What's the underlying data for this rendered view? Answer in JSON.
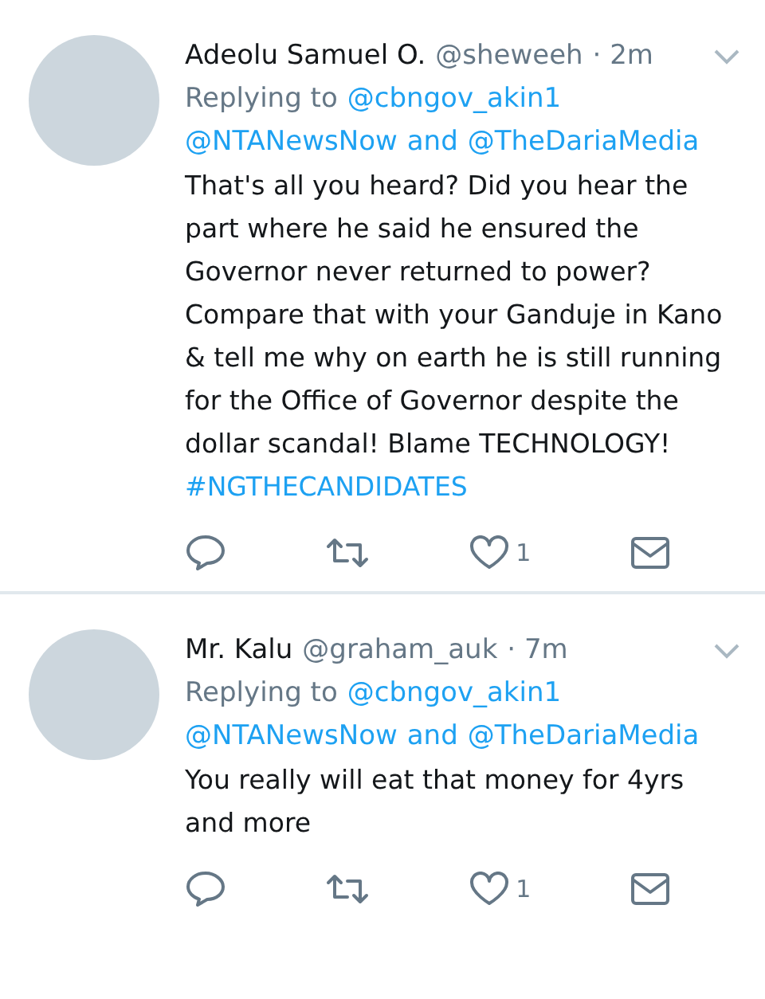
{
  "tweets": [
    {
      "name": "Adeolu Samuel O.",
      "handle": "@sheweeh",
      "time": "· 2m",
      "reply_lines": [
        [
          {
            "kind": "label",
            "text": "Replying to"
          },
          {
            "kind": "link",
            "text": "@cbngov_akin1"
          }
        ],
        [
          {
            "kind": "link",
            "text": "@NTANewsNow"
          },
          {
            "kind": "joiner",
            "text": "and"
          },
          {
            "kind": "link",
            "text": "@TheDariaMedia"
          }
        ]
      ],
      "text": "That's all you heard? Did you hear the part where he said he ensured the Governor never returned to power? Compare that with your Ganduje in Kano & tell me why on earth he is still running for the Office of Governor despite the dollar scandal! Blame TECHNOLOGY!",
      "hashtag": "#NGTHECANDIDATES",
      "likes": "1"
    },
    {
      "name": "Mr. Kalu",
      "handle": "@graham_auk",
      "time": "· 7m",
      "reply_lines": [
        [
          {
            "kind": "label",
            "text": "Replying to"
          },
          {
            "kind": "link",
            "text": "@cbngov_akin1"
          }
        ],
        [
          {
            "kind": "link",
            "text": "@NTANewsNow"
          },
          {
            "kind": "joiner",
            "text": "and"
          },
          {
            "kind": "link",
            "text": "@TheDariaMedia"
          }
        ]
      ],
      "text": "You really will eat that money for 4yrs and more",
      "likes": "1"
    }
  ]
}
